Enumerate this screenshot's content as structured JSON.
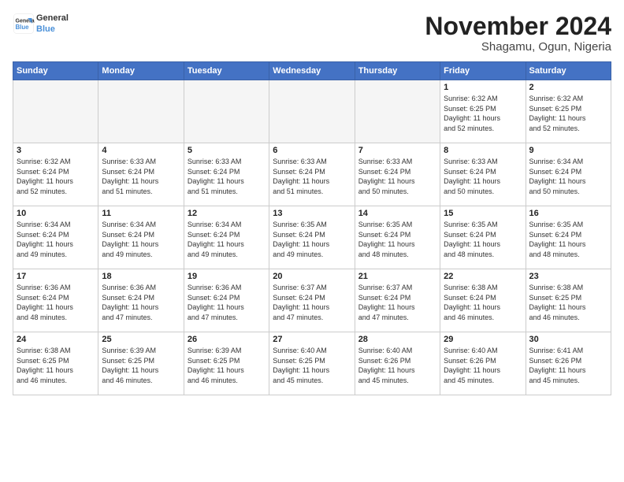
{
  "header": {
    "logo_line1": "General",
    "logo_line2": "Blue",
    "month": "November 2024",
    "location": "Shagamu, Ogun, Nigeria"
  },
  "weekdays": [
    "Sunday",
    "Monday",
    "Tuesday",
    "Wednesday",
    "Thursday",
    "Friday",
    "Saturday"
  ],
  "weeks": [
    [
      {
        "day": "",
        "info": ""
      },
      {
        "day": "",
        "info": ""
      },
      {
        "day": "",
        "info": ""
      },
      {
        "day": "",
        "info": ""
      },
      {
        "day": "",
        "info": ""
      },
      {
        "day": "1",
        "info": "Sunrise: 6:32 AM\nSunset: 6:25 PM\nDaylight: 11 hours\nand 52 minutes."
      },
      {
        "day": "2",
        "info": "Sunrise: 6:32 AM\nSunset: 6:25 PM\nDaylight: 11 hours\nand 52 minutes."
      }
    ],
    [
      {
        "day": "3",
        "info": "Sunrise: 6:32 AM\nSunset: 6:24 PM\nDaylight: 11 hours\nand 52 minutes."
      },
      {
        "day": "4",
        "info": "Sunrise: 6:33 AM\nSunset: 6:24 PM\nDaylight: 11 hours\nand 51 minutes."
      },
      {
        "day": "5",
        "info": "Sunrise: 6:33 AM\nSunset: 6:24 PM\nDaylight: 11 hours\nand 51 minutes."
      },
      {
        "day": "6",
        "info": "Sunrise: 6:33 AM\nSunset: 6:24 PM\nDaylight: 11 hours\nand 51 minutes."
      },
      {
        "day": "7",
        "info": "Sunrise: 6:33 AM\nSunset: 6:24 PM\nDaylight: 11 hours\nand 50 minutes."
      },
      {
        "day": "8",
        "info": "Sunrise: 6:33 AM\nSunset: 6:24 PM\nDaylight: 11 hours\nand 50 minutes."
      },
      {
        "day": "9",
        "info": "Sunrise: 6:34 AM\nSunset: 6:24 PM\nDaylight: 11 hours\nand 50 minutes."
      }
    ],
    [
      {
        "day": "10",
        "info": "Sunrise: 6:34 AM\nSunset: 6:24 PM\nDaylight: 11 hours\nand 49 minutes."
      },
      {
        "day": "11",
        "info": "Sunrise: 6:34 AM\nSunset: 6:24 PM\nDaylight: 11 hours\nand 49 minutes."
      },
      {
        "day": "12",
        "info": "Sunrise: 6:34 AM\nSunset: 6:24 PM\nDaylight: 11 hours\nand 49 minutes."
      },
      {
        "day": "13",
        "info": "Sunrise: 6:35 AM\nSunset: 6:24 PM\nDaylight: 11 hours\nand 49 minutes."
      },
      {
        "day": "14",
        "info": "Sunrise: 6:35 AM\nSunset: 6:24 PM\nDaylight: 11 hours\nand 48 minutes."
      },
      {
        "day": "15",
        "info": "Sunrise: 6:35 AM\nSunset: 6:24 PM\nDaylight: 11 hours\nand 48 minutes."
      },
      {
        "day": "16",
        "info": "Sunrise: 6:35 AM\nSunset: 6:24 PM\nDaylight: 11 hours\nand 48 minutes."
      }
    ],
    [
      {
        "day": "17",
        "info": "Sunrise: 6:36 AM\nSunset: 6:24 PM\nDaylight: 11 hours\nand 48 minutes."
      },
      {
        "day": "18",
        "info": "Sunrise: 6:36 AM\nSunset: 6:24 PM\nDaylight: 11 hours\nand 47 minutes."
      },
      {
        "day": "19",
        "info": "Sunrise: 6:36 AM\nSunset: 6:24 PM\nDaylight: 11 hours\nand 47 minutes."
      },
      {
        "day": "20",
        "info": "Sunrise: 6:37 AM\nSunset: 6:24 PM\nDaylight: 11 hours\nand 47 minutes."
      },
      {
        "day": "21",
        "info": "Sunrise: 6:37 AM\nSunset: 6:24 PM\nDaylight: 11 hours\nand 47 minutes."
      },
      {
        "day": "22",
        "info": "Sunrise: 6:38 AM\nSunset: 6:24 PM\nDaylight: 11 hours\nand 46 minutes."
      },
      {
        "day": "23",
        "info": "Sunrise: 6:38 AM\nSunset: 6:25 PM\nDaylight: 11 hours\nand 46 minutes."
      }
    ],
    [
      {
        "day": "24",
        "info": "Sunrise: 6:38 AM\nSunset: 6:25 PM\nDaylight: 11 hours\nand 46 minutes."
      },
      {
        "day": "25",
        "info": "Sunrise: 6:39 AM\nSunset: 6:25 PM\nDaylight: 11 hours\nand 46 minutes."
      },
      {
        "day": "26",
        "info": "Sunrise: 6:39 AM\nSunset: 6:25 PM\nDaylight: 11 hours\nand 46 minutes."
      },
      {
        "day": "27",
        "info": "Sunrise: 6:40 AM\nSunset: 6:25 PM\nDaylight: 11 hours\nand 45 minutes."
      },
      {
        "day": "28",
        "info": "Sunrise: 6:40 AM\nSunset: 6:26 PM\nDaylight: 11 hours\nand 45 minutes."
      },
      {
        "day": "29",
        "info": "Sunrise: 6:40 AM\nSunset: 6:26 PM\nDaylight: 11 hours\nand 45 minutes."
      },
      {
        "day": "30",
        "info": "Sunrise: 6:41 AM\nSunset: 6:26 PM\nDaylight: 11 hours\nand 45 minutes."
      }
    ]
  ]
}
